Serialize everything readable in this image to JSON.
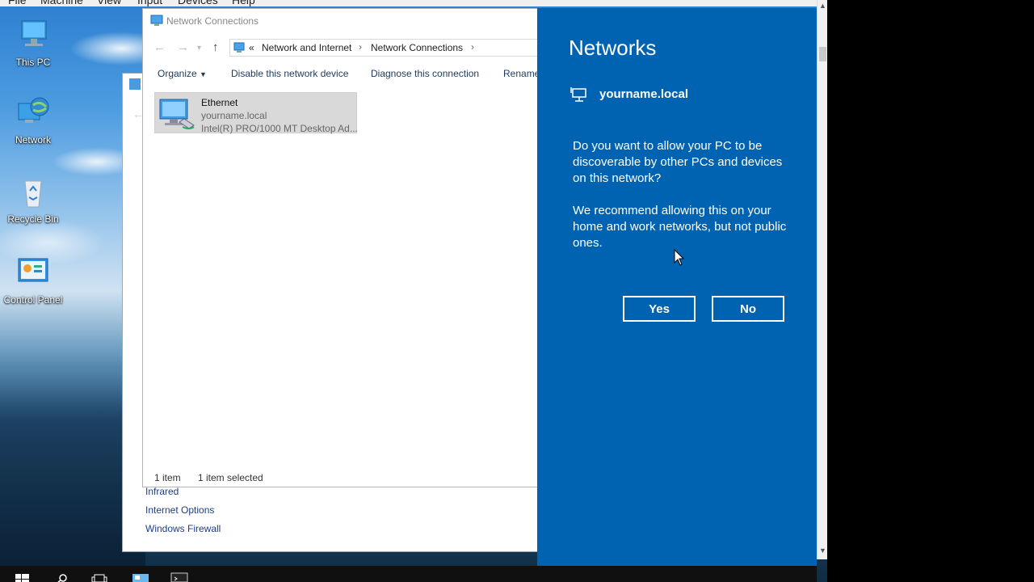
{
  "vm_menu": [
    "File",
    "Machine",
    "View",
    "Input",
    "Devices",
    "Help"
  ],
  "desktop_icons": [
    {
      "label": "This PC",
      "icon": "this-pc-icon"
    },
    {
      "label": "Network",
      "icon": "network-globe-icon"
    },
    {
      "label": "Recycle Bin",
      "icon": "recycle-bin-icon"
    },
    {
      "label": "Control Panel",
      "icon": "control-panel-icon"
    }
  ],
  "control_panel_links": [
    "Infrared",
    "Internet Options",
    "Windows Firewall"
  ],
  "network_connections": {
    "title": "Network Connections",
    "breadcrumb": {
      "prefix": "«",
      "items": [
        "Network and Internet",
        "Network Connections"
      ]
    },
    "toolbar": {
      "organize": "Organize",
      "disable": "Disable this network device",
      "diagnose": "Diagnose this connection",
      "rename": "Rename"
    },
    "item": {
      "name": "Ethernet",
      "network": "yourname.local",
      "adapter": "Intel(R) PRO/1000 MT Desktop Ad..."
    },
    "status": {
      "count": "1 item",
      "selected": "1 item selected"
    }
  },
  "flyout": {
    "title": "Networks",
    "network_name": "yourname.local",
    "question": "Do you want to allow your PC to be discoverable by other PCs and devices on this network?",
    "recommendation": "We recommend allowing this on your home and work networks, but not public ones.",
    "yes_label": "Yes",
    "no_label": "No",
    "background_color": "#0063b1"
  }
}
